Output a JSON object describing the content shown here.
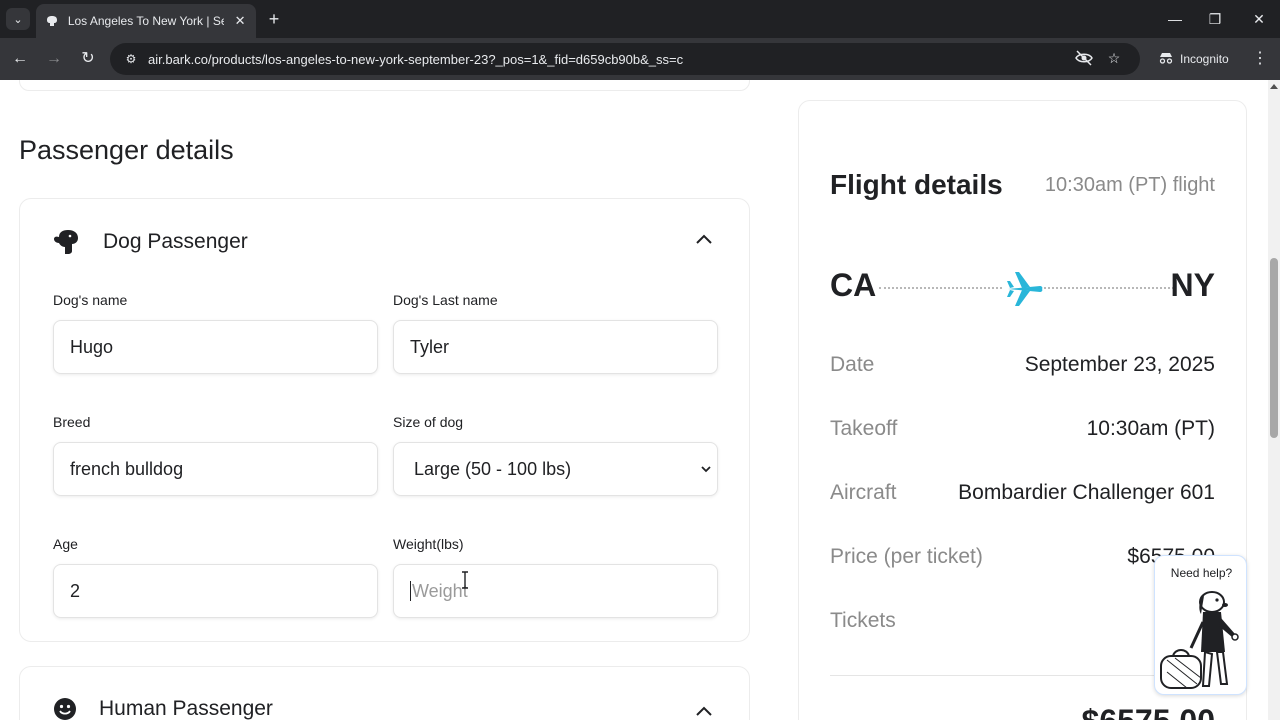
{
  "browser": {
    "tab_title": "Los Angeles To New York | Septe",
    "url": "air.bark.co/products/los-angeles-to-new-york-september-23?_pos=1&_fid=d659cb90b&_ss=c",
    "profile_label": "Incognito",
    "icons": [
      "tab-search-icon",
      "close-icon",
      "new-tab-icon",
      "minimize-icon",
      "restore-icon",
      "window-close-icon",
      "back-icon",
      "forward-icon",
      "reload-icon",
      "site-info-icon",
      "eye-off-icon",
      "star-icon",
      "incognito-icon",
      "kebab-menu-icon"
    ]
  },
  "passenger_details": {
    "section_title": "Passenger details",
    "dog_card": {
      "title": "Dog Passenger",
      "fields": {
        "first_name": {
          "label": "Dog's name",
          "value": "Hugo"
        },
        "last_name": {
          "label": "Dog's Last name",
          "value": "Tyler"
        },
        "breed": {
          "label": "Breed",
          "value": "french bulldog"
        },
        "size": {
          "label": "Size of dog",
          "value": "Large (50 - 100 lbs)"
        },
        "age": {
          "label": "Age",
          "value": "2"
        },
        "weight": {
          "label": "Weight(lbs)",
          "value": "",
          "placeholder": "Weight"
        }
      }
    },
    "human_card": {
      "title": "Human Passenger"
    }
  },
  "flight_details": {
    "title": "Flight details",
    "subtitle": "10:30am (PT) flight",
    "from": "CA",
    "to": "NY",
    "rows": {
      "date": {
        "label": "Date",
        "value": "September 23, 2025"
      },
      "takeoff": {
        "label": "Takeoff",
        "value": "10:30am (PT)"
      },
      "aircraft": {
        "label": "Aircraft",
        "value": "Bombardier Challenger 601"
      },
      "price": {
        "label": "Price (per ticket)",
        "value": "$6575.00"
      },
      "tickets": {
        "label": "Tickets",
        "value": ""
      }
    },
    "total_peek": "$6575.00"
  },
  "help_widget": {
    "label": "Need help?"
  },
  "colors": {
    "accent_plane": "#29b6d9",
    "browser_dark": "#202124",
    "browser_toolbar": "#35363a"
  }
}
